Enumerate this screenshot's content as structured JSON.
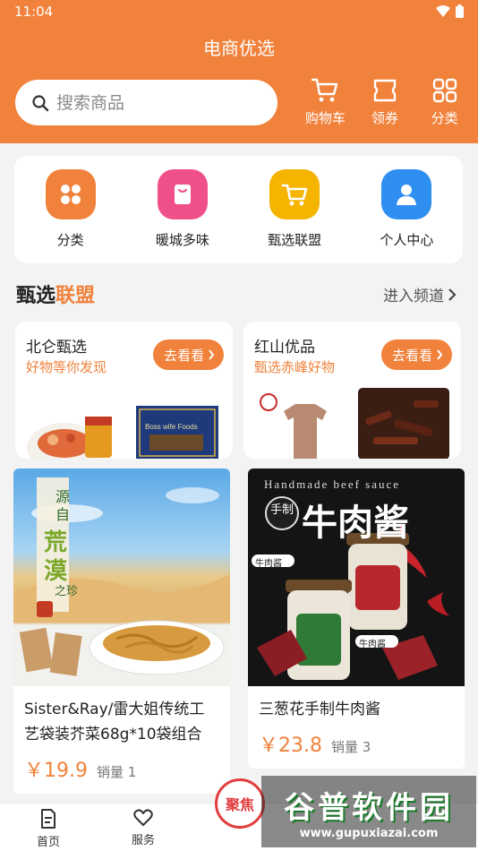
{
  "status_bar": {
    "time": "11:04"
  },
  "app_title": "电商优选",
  "search": {
    "placeholder": "搜索商品",
    "value": ""
  },
  "header_actions": [
    {
      "label": "购物车",
      "icon": "cart-icon"
    },
    {
      "label": "领券",
      "icon": "coupon-icon"
    },
    {
      "label": "分类",
      "icon": "grid-icon"
    }
  ],
  "shortcuts": [
    {
      "label": "分类",
      "icon": "category-icon",
      "color": "#f0823c"
    },
    {
      "label": "暖城多味",
      "icon": "bag-icon",
      "color": "#f0508a"
    },
    {
      "label": "甄选联盟",
      "icon": "cart-icon",
      "color": "#f5b400"
    },
    {
      "label": "个人中心",
      "icon": "user-icon",
      "color": "#2f8ff0"
    }
  ],
  "section": {
    "title_a": "甄选",
    "title_b": "联盟",
    "more": "进入频道"
  },
  "channels": [
    {
      "name": "北仑甄选",
      "sub": "好物等你发现",
      "button": "去看看",
      "image_text": "Boss wife Foods"
    },
    {
      "name": "红山优品",
      "sub": "甄选赤峰好物",
      "button": "去看看"
    }
  ],
  "products": [
    {
      "name": "Sister&Ray/雷大姐传统工艺袋装芥菜68g*10袋组合",
      "price": "￥19.9",
      "sales_label": "销量",
      "sales": "1",
      "image_text": [
        "源",
        "自",
        "荒",
        "漠",
        "之珍"
      ]
    },
    {
      "name": "三葱花手制牛肉酱",
      "price": "￥23.8",
      "sales_label": "销量",
      "sales": "3",
      "image_text": {
        "top": "Handmade beef sauce",
        "title": "牛肉酱",
        "badge": "手制",
        "tag": "牛肉酱"
      }
    }
  ],
  "tabbar": {
    "items": [
      {
        "label": "首页",
        "icon": "home-doc-icon"
      },
      {
        "label": "服务",
        "icon": "heart-icon"
      }
    ],
    "center": "聚焦"
  },
  "watermark": {
    "title": "谷普软件园",
    "url": "www.gupuxiazai.com"
  },
  "colors": {
    "brand": "#f0823c",
    "price": "#f0823c",
    "center_tab": "#e23d3d"
  }
}
